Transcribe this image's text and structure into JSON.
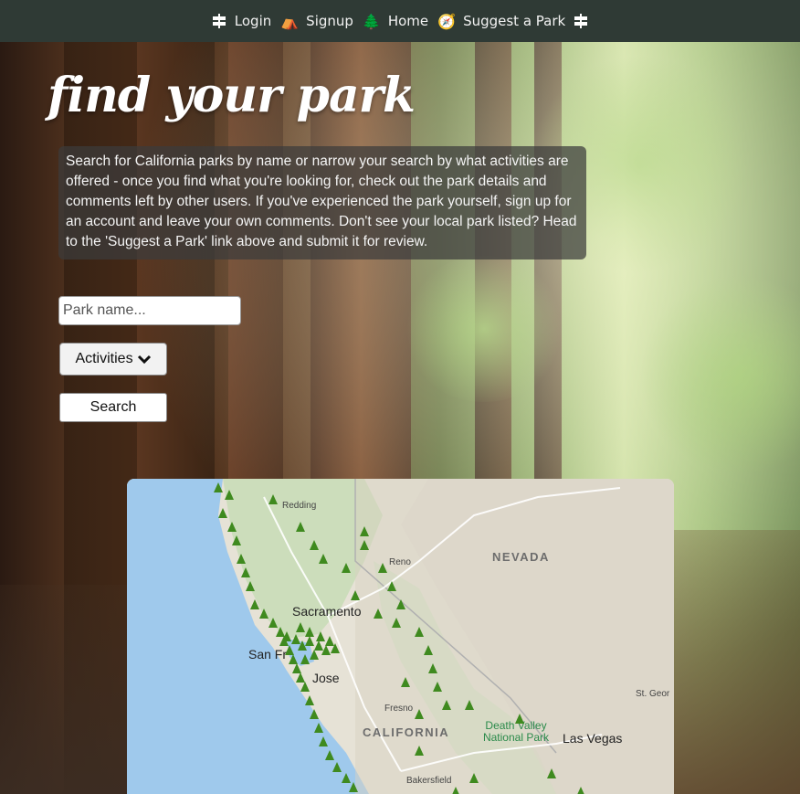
{
  "nav": {
    "items": [
      {
        "label": "Login",
        "icon": "signpost-icon"
      },
      {
        "label": "Signup",
        "icon": "tent-icon"
      },
      {
        "label": "Home",
        "icon": "tree-icon"
      },
      {
        "label": "Suggest a Park",
        "icon": "compass-icon"
      }
    ]
  },
  "page": {
    "title": "find your park",
    "intro": "Search for California parks by name or narrow your search by what activities are offered - once you find what you're looking for, check out the park details and comments left by other users. If you've experienced the park yourself, sign up for an account and leave your own comments. Don't see your local park listed? Head to the 'Suggest a Park' link above and submit it for review."
  },
  "search": {
    "placeholder": "Park name...",
    "activities_label": "Activities",
    "button_label": "Search"
  },
  "map": {
    "labels": {
      "redding": "Redding",
      "reno": "Reno",
      "nevada": "NEVADA",
      "sacramento": "Sacramento",
      "san_francisco": "San Fr",
      "san_jose": "Jose",
      "fresno": "Fresno",
      "california": "CALIFORNIA",
      "death_valley": "Death Valley National Park",
      "las_vegas": "Las Vegas",
      "st_george": "St. Geor",
      "bakersfield": "Bakersfield"
    },
    "marker_color": "#3f8a1f"
  },
  "colors": {
    "nav_bg": "#2f3a35",
    "intro_bg": "rgba(60,60,60,0.72)"
  }
}
